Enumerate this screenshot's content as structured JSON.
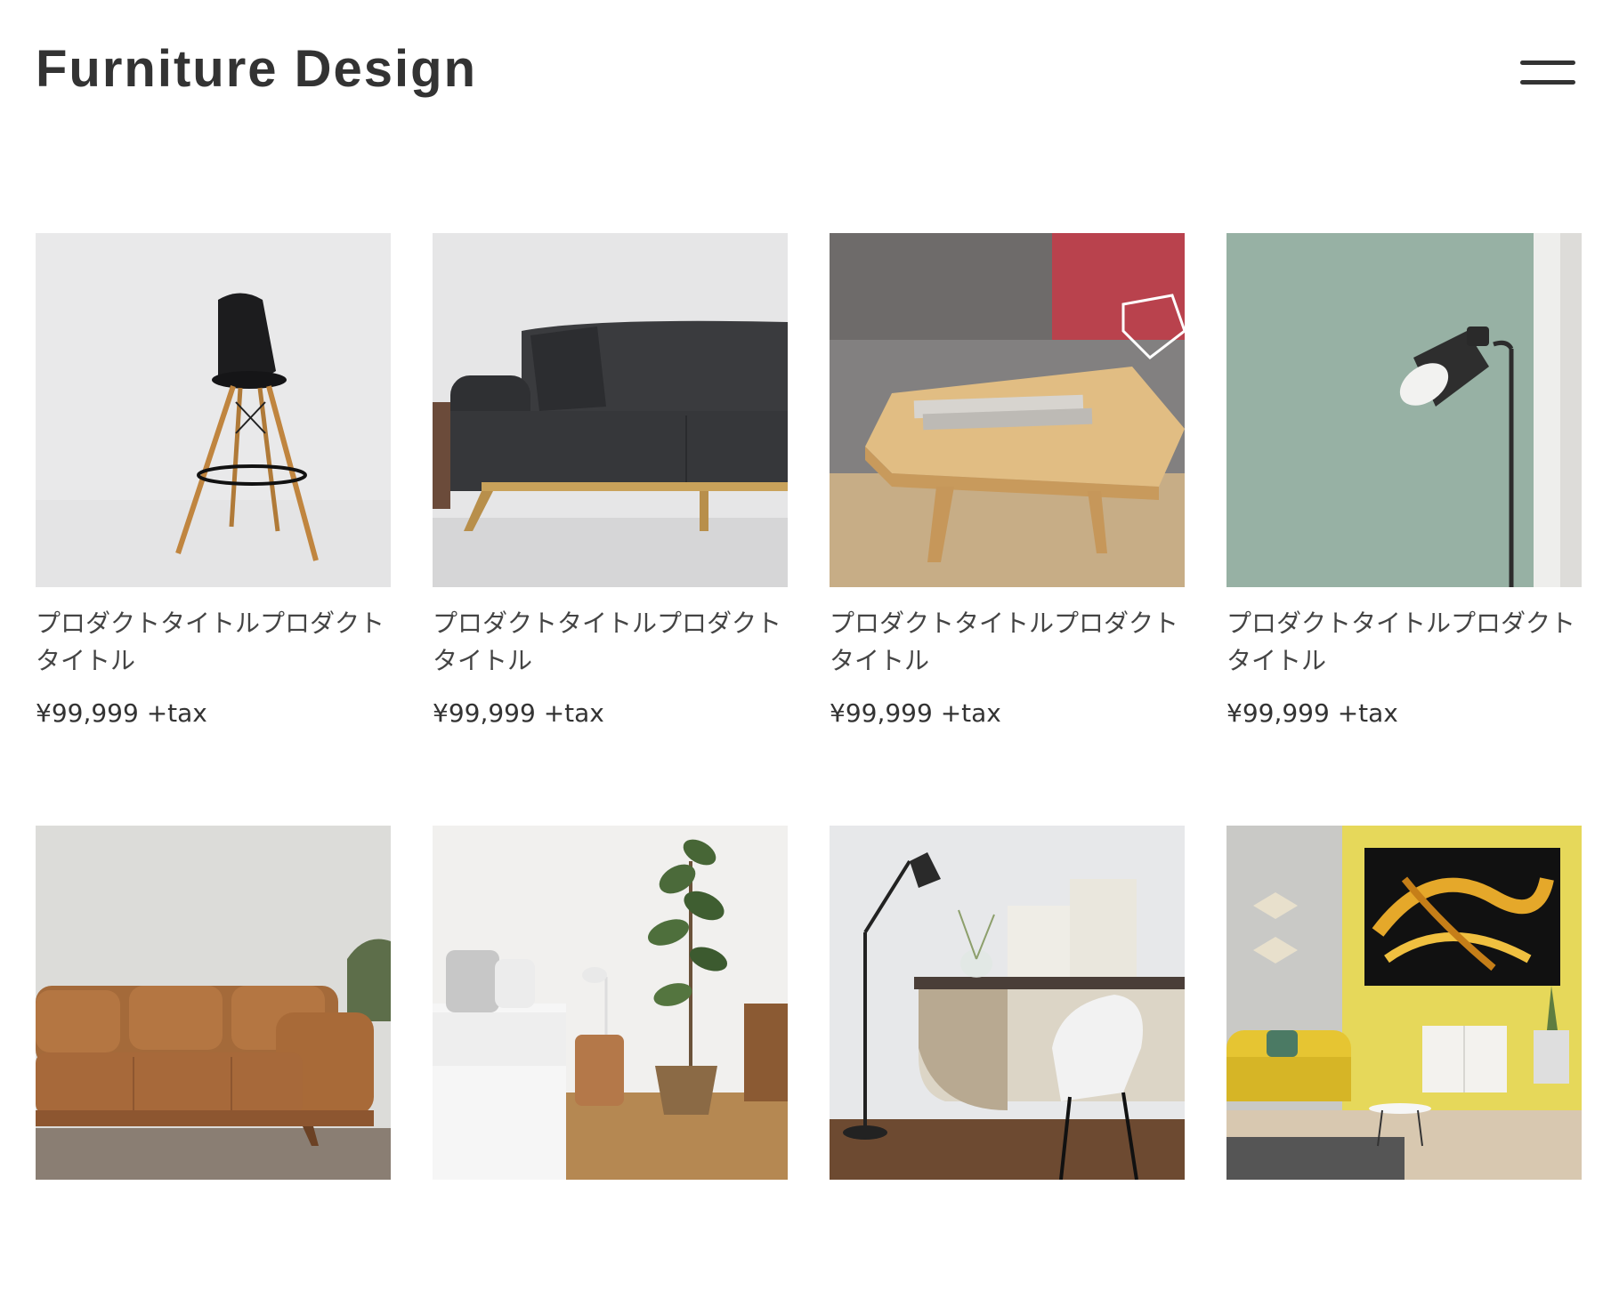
{
  "header": {
    "logo": "Furniture Design",
    "menu_icon": "hamburger-menu-icon"
  },
  "products": [
    {
      "title": "プロダクトタイトルプロダクトタイトル",
      "price": "¥99,999 +tax",
      "image": "black-bar-stool-photo"
    },
    {
      "title": "プロダクトタイトルプロダクトタイトル",
      "price": "¥99,999 +tax",
      "image": "dark-gray-sofa-photo"
    },
    {
      "title": "プロダクトタイトルプロダクトタイトル",
      "price": "¥99,999 +tax",
      "image": "wooden-coffee-table-photo"
    },
    {
      "title": "プロダクトタイトルプロダクトタイトル",
      "price": "¥99,999 +tax",
      "image": "black-floor-lamp-photo"
    },
    {
      "title": "",
      "price": "",
      "image": "brown-leather-sofa-photo"
    },
    {
      "title": "",
      "price": "",
      "image": "bedroom-with-plant-photo"
    },
    {
      "title": "",
      "price": "",
      "image": "desk-with-floor-lamp-photo"
    },
    {
      "title": "",
      "price": "",
      "image": "yellow-living-room-photo"
    }
  ],
  "colors": {
    "text": "#333333",
    "background": "#ffffff"
  }
}
